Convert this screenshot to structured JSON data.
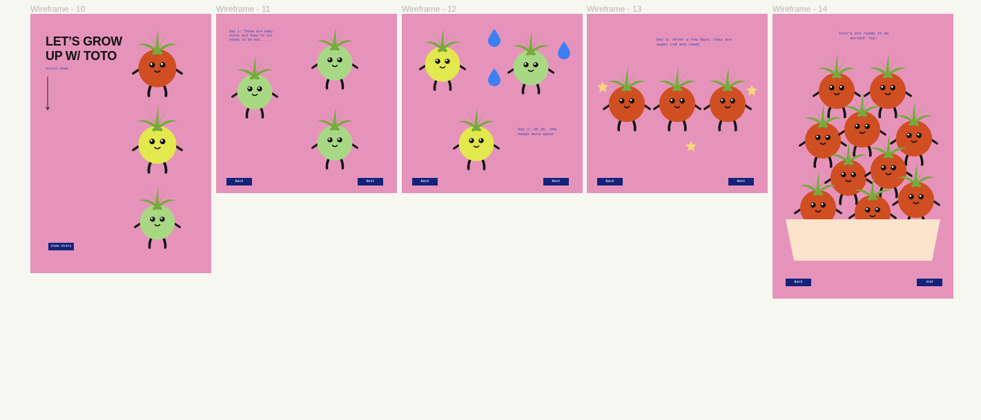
{
  "canvas": {
    "frames": [
      {
        "label": "Wireframe - 10"
      },
      {
        "label": "Wireframe - 11"
      },
      {
        "label": "Wireframe - 12"
      },
      {
        "label": "Wireframe - 13"
      },
      {
        "label": "Wireframe - 14"
      }
    ]
  },
  "colors": {
    "canvas_bg": "#f6f7f1",
    "frame_bg": "#e693bb",
    "button_bg": "#14237a",
    "caption_text": "#2d3fa6",
    "ripe": "#cf4e22",
    "unripe": "#e2e84d",
    "baby": "#a9d884",
    "water": "#3c7ff2",
    "star": "#f6d77a",
    "bowl": "#fce4cc"
  },
  "icons": [
    "tomato-character-icon",
    "water-drop-icon",
    "sparkle-star-icon",
    "down-arrow-icon",
    "bowl-icon"
  ],
  "wf10": {
    "title": "LET’S GROW UP W/ TOTO",
    "scroll_hint": "Scroll Down",
    "view_story": "View Story"
  },
  "wf11": {
    "caption": "Day 1: These are baby totos and they're not ready to be eat....",
    "back": "Back",
    "next": "Next"
  },
  "wf12": {
    "caption": "Day 2: Uh oh, one needs more water",
    "back": "Back",
    "next": "Next"
  },
  "wf13": {
    "caption": "Day 3: After a few days, they are super red and ready",
    "back": "Back",
    "next": "Next"
  },
  "wf14": {
    "caption": "Toto's are ready to be served! Yay!",
    "back": "Back",
    "end": "End"
  }
}
